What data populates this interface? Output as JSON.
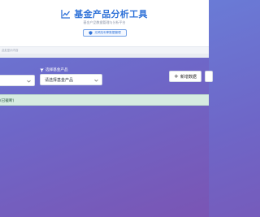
{
  "header": {
    "title": "基金产品分析工具",
    "subtitle": "基金产品数据管理与分析平台",
    "badge_label": "无风险利率数据管理",
    "strip_note": "此处显示内容"
  },
  "filters": {
    "label": "选择基金产品",
    "left_select_value": "",
    "fund_select_value": "请选择基金产品"
  },
  "actions": {
    "add_label": "新增数据"
  },
  "alert": {
    "text": "(已截断)"
  },
  "colors": {
    "accent": "#2f72d8",
    "background_start": "#6a7bd6",
    "background_end": "#7a55b4",
    "alert_bg": "#d6ebe1"
  }
}
